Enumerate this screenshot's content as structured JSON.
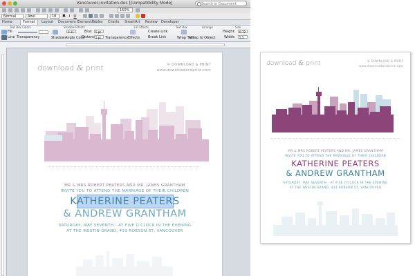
{
  "window": {
    "doc_title": "Vancouver-invitation.doc [Compatibility Mode]",
    "search_placeholder": "Search in Document",
    "zoom": "150%"
  },
  "format_bar": {
    "style": "Normal",
    "font": "Abel",
    "size": "18",
    "bold": "B",
    "italic": "I",
    "underline": "U"
  },
  "ribbon_tabs": [
    "Home",
    "Format",
    "Layout",
    "Document Elements",
    "Tables",
    "Charts",
    "SmartArt",
    "Review",
    "Developer"
  ],
  "ribbon_active_tab": "Format",
  "ribbon": {
    "groups": [
      "Text Box Colors",
      "Shadow Effects",
      "3-D Effects",
      "Text Box",
      "Arrange",
      "Size"
    ],
    "fill": "Fill",
    "line": "Line",
    "transparency": "Transparency",
    "shadow": "Shadow",
    "angle": "Angle",
    "color": "Color",
    "blur": "Blur:",
    "distance": "Distance:",
    "effects": "Effects",
    "create_link": "Create Link",
    "break_link": "Break Link",
    "wrap_text": "Wrap Text",
    "wrap_to_object": "Wrap to Object",
    "height_label": "Height:",
    "height_value": "0.72",
    "width_label": "Width:",
    "width_value": "5.5",
    "angle_value": "0.11",
    "blur_value": "5 pt",
    "distance_value": "5 pt"
  },
  "invitation": {
    "brand_left": "download",
    "brand_mark": "&",
    "brand_right": "print",
    "brand_sub1": "© DOWNLOAD & PRINT",
    "brand_sub2": "www.downloadandprint.com",
    "line1": "MR & MRS ROBERT PEATERS AND MR. JAMES GRANTHAM",
    "line2": "INVITE YOU TO ATTEND THE MARRIAGE OF THEIR CHILDREN",
    "name1": "KATHERINE PEATERS",
    "name2": "& ANDREW GRANTHAM",
    "date": "SATURDAY, MAY SEVENTH - AT FIVE O'CLOCK IN THE EVENING",
    "venue": "AT THE WESTIN GRAND, 433 ROBSON ST, VANCOUVER"
  },
  "colors": {
    "skyline_doc": "#dab9d0",
    "skyline_card": "#8c4579",
    "skyline_card_light": "#c9a3bd",
    "skyline_card_teal": "#b9d3dc",
    "names_doc": "#3f87a9",
    "names_card_1": "#8d3f79",
    "names_card_2": "#3c7f98",
    "text_purple": "#9b7a96",
    "text_teal": "#5c9cb0",
    "selection": "#bcd6f3"
  }
}
